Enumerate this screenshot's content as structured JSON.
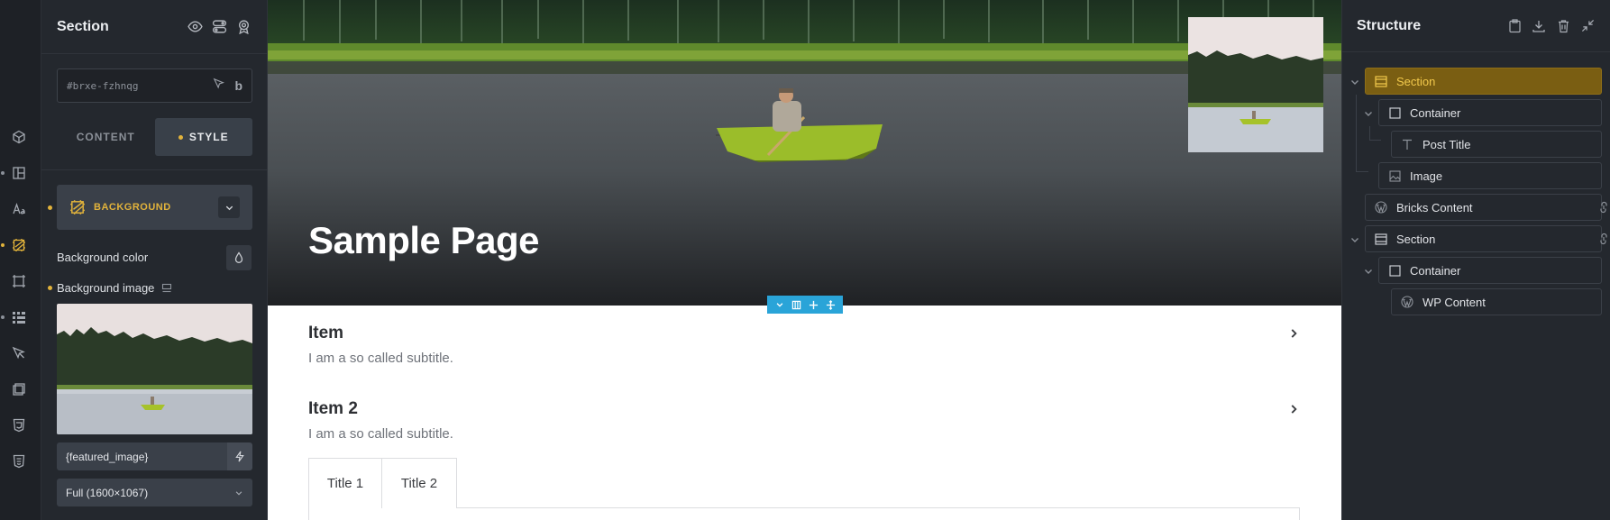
{
  "rail": {
    "icons": [
      "cube-icon",
      "layout-icon",
      "typography-icon",
      "background-icon",
      "border-icon",
      "grid-icon",
      "cursor-icon",
      "transform-icon",
      "css-icon",
      "css-classes-icon"
    ]
  },
  "panel": {
    "title": "Section",
    "head_icons": [
      "eye-icon",
      "toggle-icon",
      "badge-icon"
    ],
    "element_id": "#brxe-fzhnqg",
    "id_button": "b",
    "tabs": {
      "content": "CONTENT",
      "style": "STYLE"
    },
    "group_label": "BACKGROUND",
    "background_color_label": "Background color",
    "background_image_label": "Background image",
    "dynamic_value": "{featured_image}",
    "size_value": "Full (1600×1067)"
  },
  "canvas": {
    "hero_title": "Sample Page",
    "accordion": [
      {
        "title": "Item",
        "subtitle": "I am a so called subtitle."
      },
      {
        "title": "Item 2",
        "subtitle": "I am a so called subtitle."
      }
    ],
    "tabs": [
      "Title 1",
      "Title 2"
    ]
  },
  "structure": {
    "title": "Structure",
    "head_icons": [
      "clipboard-icon",
      "download-icon",
      "trash-icon",
      "collapse-icon"
    ],
    "nodes": [
      {
        "label": "Section",
        "icon": "section-icon"
      },
      {
        "label": "Container",
        "icon": "container-icon"
      },
      {
        "label": "Post Title",
        "icon": "text-icon"
      },
      {
        "label": "Image",
        "icon": "image-icon"
      },
      {
        "label": "Bricks Content",
        "icon": "wordpress-icon"
      },
      {
        "label": "Section",
        "icon": "section-icon"
      },
      {
        "label": "Container",
        "icon": "container-icon"
      },
      {
        "label": "WP Content",
        "icon": "wordpress-icon"
      }
    ]
  },
  "colors": {
    "accent": "#e2b33b",
    "selection": "#2aa4d8",
    "panel_bg": "#24282e",
    "active_node_bg": "#7a5e12"
  }
}
